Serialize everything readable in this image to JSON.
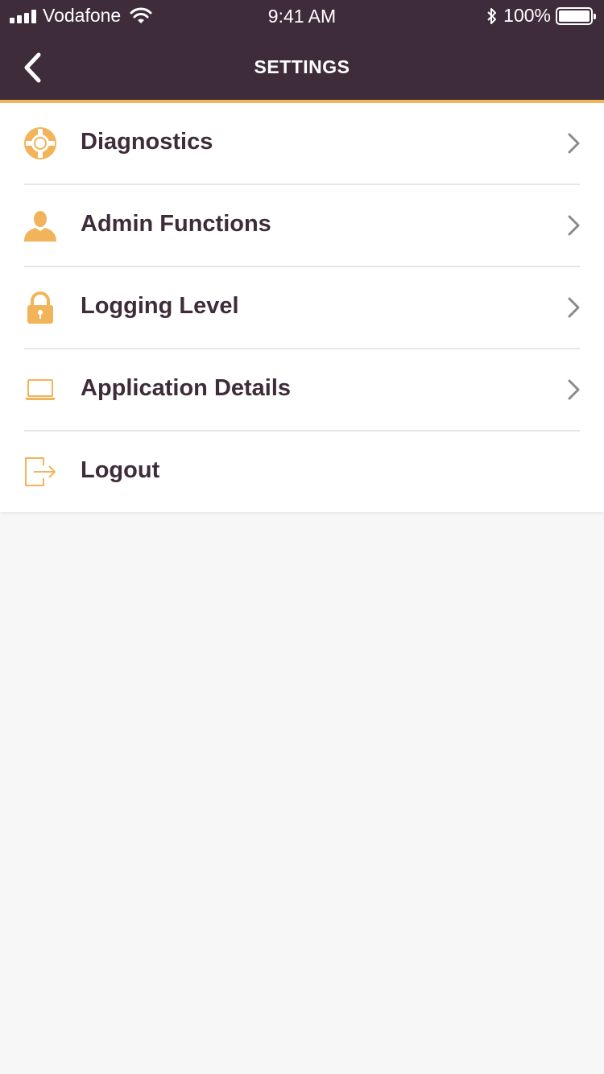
{
  "status_bar": {
    "carrier": "Vodafone",
    "time": "9:41 AM",
    "battery_percent": "100%",
    "battery_level": 1.0
  },
  "header": {
    "title": "SETTINGS",
    "back_icon": "chevron-left-icon"
  },
  "colors": {
    "header_bg": "#3f2c3b",
    "accent": "#f2b45a",
    "label": "#3f2c3b",
    "chevron": "#8a8a8a",
    "background": "#f7f7f7"
  },
  "settings": {
    "items": [
      {
        "label": "Diagnostics",
        "icon": "lifebuoy-icon",
        "has_chevron": true
      },
      {
        "label": "Admin Functions",
        "icon": "user-icon",
        "has_chevron": true
      },
      {
        "label": "Logging Level",
        "icon": "lock-icon",
        "has_chevron": true
      },
      {
        "label": "Application Details",
        "icon": "laptop-icon",
        "has_chevron": true
      },
      {
        "label": "Logout",
        "icon": "logout-icon",
        "has_chevron": false
      }
    ]
  }
}
